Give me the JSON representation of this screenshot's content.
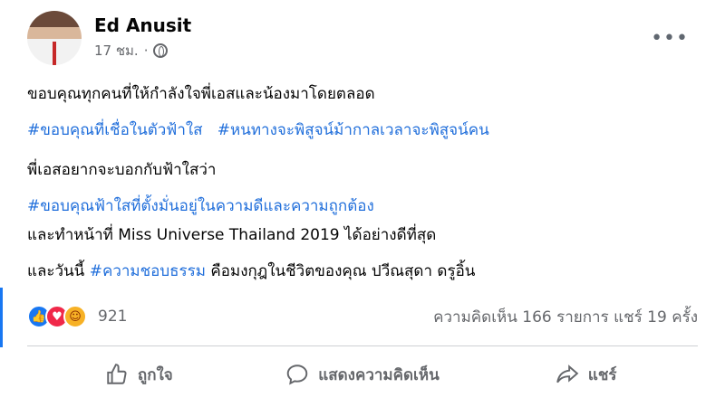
{
  "post": {
    "author": "Ed Anusit",
    "timestamp": "17 ชม.",
    "separator": "·",
    "privacy_icon": "globe-icon",
    "lines": [
      [
        {
          "t": "ขอบคุณทุกคนที่ให้กำลังใจพี่เอสและน้องมาโดยตลอด",
          "tag": false
        }
      ],
      [
        {
          "t": "#ขอบคุณที่เชื่อในตัวฟ้าใส",
          "tag": true
        },
        {
          "t": "   ",
          "tag": false
        },
        {
          "t": "#หนทางจะพิสูจน์ม้ากาลเวลาจะพิสูจน์คน",
          "tag": true
        }
      ],
      [
        {
          "t": "พี่เอสอยากจะบอกกับฟ้าใสว่า",
          "tag": false
        }
      ],
      [
        {
          "t": "#ขอบคุณฟ้าใสที่ตั้งมั่นอยู่ในความดีและความถูกต้อง",
          "tag": true
        }
      ],
      [
        {
          "t": "และทำหน้าที่ Miss Universe Thailand 2019 ได้อย่างดีที่สุด",
          "tag": false
        }
      ],
      [
        {
          "t": "และวันนี้ ",
          "tag": false
        },
        {
          "t": "#ความชอบธรรม",
          "tag": true
        },
        {
          "t": " คือมงกุฎในชีวิตของคุณ ปวีณสุดา ดรูอิ้น",
          "tag": false
        }
      ]
    ]
  },
  "stats": {
    "reaction_count": "921",
    "comments_shares": "ความคิดเห็น 166 รายการ  แชร์ 19 ครั้ง"
  },
  "actions": {
    "like": "ถูกใจ",
    "comment": "แสดงความคิดเห็น",
    "share": "แชร์"
  },
  "more_label": "•••",
  "colors": {
    "hashtag": "#216fdb",
    "accent": "#1877f2"
  }
}
